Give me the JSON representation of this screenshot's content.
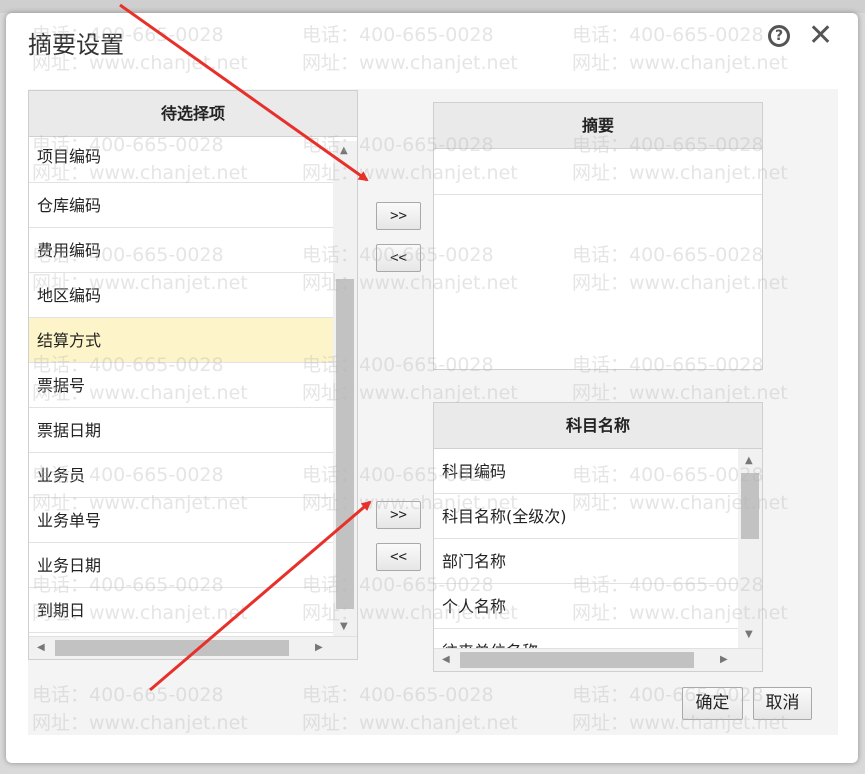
{
  "dialog": {
    "title": "摘要设置",
    "help_icon": "help-icon",
    "close_icon": "close-icon",
    "help_glyph": "?",
    "close_glyph": "✕"
  },
  "available_panel": {
    "header": "待选择项",
    "items": [
      "项目编码",
      "仓库编码",
      "费用编码",
      "地区编码",
      "结算方式",
      "票据号",
      "票据日期",
      "业务员",
      "业务单号",
      "业务日期",
      "到期日"
    ],
    "selected_index": 4
  },
  "summary_panel": {
    "header": "摘要",
    "items": []
  },
  "account_panel": {
    "header": "科目名称",
    "items": [
      "科目编码",
      "科目名称(全级次)",
      "部门名称",
      "个人名称",
      "往来单位名称"
    ]
  },
  "transfer_buttons": {
    "add_top": ">>",
    "remove_top": "<<",
    "add_bottom": ">>",
    "remove_bottom": "<<"
  },
  "footer": {
    "confirm_label": "确定",
    "cancel_label": "取消"
  },
  "watermark": {
    "phone": "电话：400-665-0028",
    "url": "网址：www.chanjet.net"
  },
  "colors": {
    "selected_row": "#fdf5c9",
    "annotation_arrow": "#e8302a"
  }
}
